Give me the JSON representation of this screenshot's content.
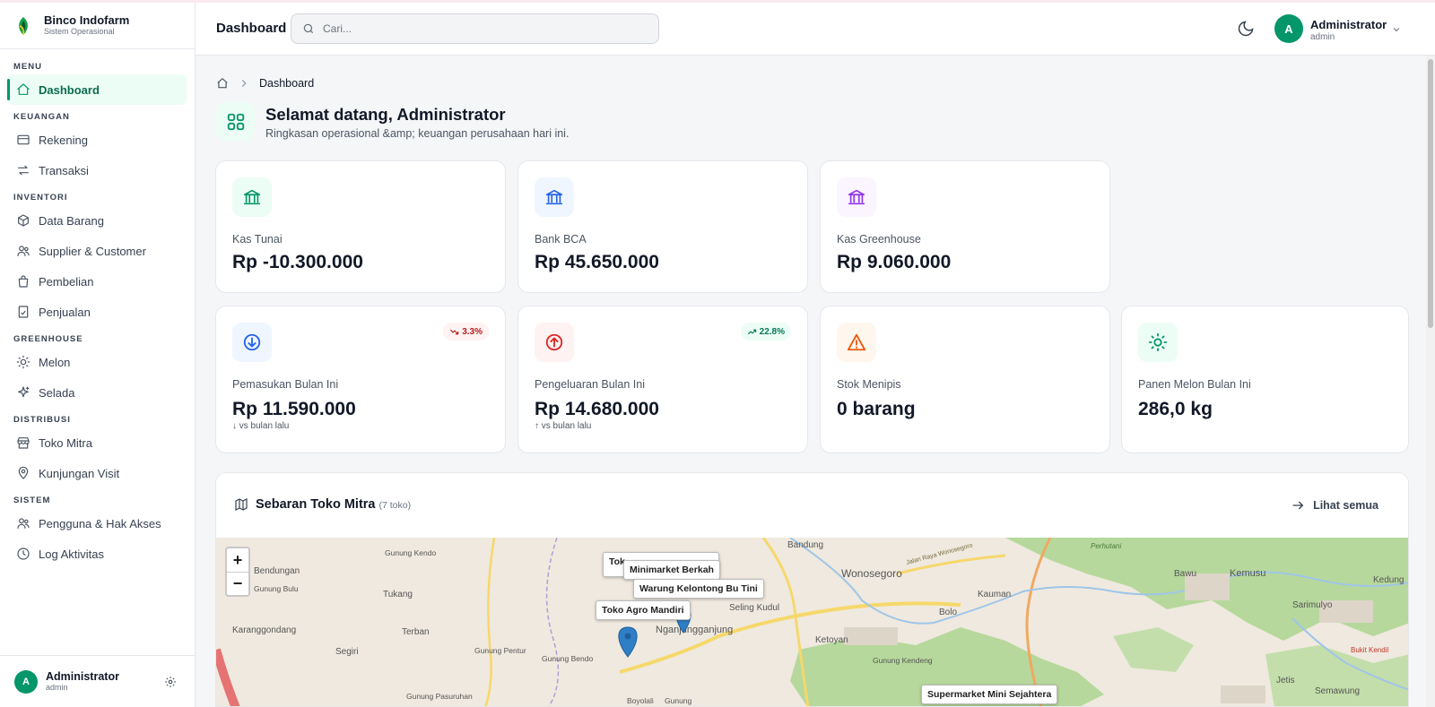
{
  "brand": {
    "name": "Binco Indofarm",
    "subtitle": "Sistem Operasional"
  },
  "sidebar": {
    "sections": [
      {
        "title": "MENU",
        "items": [
          {
            "label": "Dashboard",
            "icon": "home-icon",
            "active": true
          }
        ]
      },
      {
        "title": "KEUANGAN",
        "items": [
          {
            "label": "Rekening",
            "icon": "wallet-icon"
          },
          {
            "label": "Transaksi",
            "icon": "transfer-icon"
          }
        ]
      },
      {
        "title": "INVENTORI",
        "items": [
          {
            "label": "Data Barang",
            "icon": "box-icon"
          },
          {
            "label": "Supplier & Customer",
            "icon": "users-icon"
          },
          {
            "label": "Pembelian",
            "icon": "shopping-bag-icon"
          },
          {
            "label": "Penjualan",
            "icon": "receipt-icon"
          }
        ]
      },
      {
        "title": "GREENHOUSE",
        "items": [
          {
            "label": "Melon",
            "icon": "sun-icon"
          },
          {
            "label": "Selada",
            "icon": "sparkles-icon"
          }
        ]
      },
      {
        "title": "DISTRIBUSI",
        "items": [
          {
            "label": "Toko Mitra",
            "icon": "store-icon"
          },
          {
            "label": "Kunjungan Visit",
            "icon": "map-pin-icon"
          }
        ]
      },
      {
        "title": "SISTEM",
        "items": [
          {
            "label": "Pengguna & Hak Akses",
            "icon": "users-icon"
          },
          {
            "label": "Log Aktivitas",
            "icon": "clock-icon"
          }
        ]
      }
    ],
    "footer": {
      "avatar_initial": "A",
      "name": "Administrator",
      "role": "admin"
    }
  },
  "header": {
    "title": "Dashboard",
    "search_placeholder": "Cari...",
    "user": {
      "initial": "A",
      "name": "Administrator",
      "role": "admin"
    }
  },
  "breadcrumb": {
    "current": "Dashboard"
  },
  "welcome": {
    "title": "Selamat datang, Administrator",
    "subtitle": "Ringkasan operasional &amp; keuangan perusahaan hari ini."
  },
  "accounts": [
    {
      "label": "Kas Tunai",
      "value": "Rp -10.300.000",
      "icon": "bank-icon",
      "color": "#059669",
      "bg": "#ecfdf5"
    },
    {
      "label": "Bank BCA",
      "value": "Rp 45.650.000",
      "icon": "bank-icon",
      "color": "#2563eb",
      "bg": "#eff6ff"
    },
    {
      "label": "Kas Greenhouse",
      "value": "Rp 9.060.000",
      "icon": "bank-icon",
      "color": "#9333ea",
      "bg": "#faf5ff"
    }
  ],
  "stats": [
    {
      "label": "Pemasukan Bulan Ini",
      "value": "Rp 11.590.000",
      "note": "↓ vs bulan lalu",
      "badge": "3.3%",
      "badge_dir": "down",
      "icon": "arrow-down-circle-icon",
      "color": "#2563eb",
      "bg": "#eff6ff"
    },
    {
      "label": "Pengeluaran Bulan Ini",
      "value": "Rp 14.680.000",
      "note": "↑ vs bulan lalu",
      "badge": "22.8%",
      "badge_dir": "up",
      "icon": "arrow-up-circle-icon",
      "color": "#dc2626",
      "bg": "#fef2f2"
    },
    {
      "label": "Stok Menipis",
      "value": "0 barang",
      "icon": "alert-triangle-icon",
      "color": "#ea580c",
      "bg": "#fff7ed"
    },
    {
      "label": "Panen Melon Bulan Ini",
      "value": "286,0 kg",
      "icon": "sun-icon",
      "color": "#059669",
      "bg": "#ecfdf5"
    }
  ],
  "map": {
    "title": "Sebaran Toko Mitra",
    "count": "(7 toko)",
    "link": "Lihat semua",
    "zoom_in": "+",
    "zoom_out": "−",
    "places": [
      "Bendungan",
      "Gunung Kendo",
      "Gunung Bulu",
      "Tukang",
      "Karanggondang",
      "Terban",
      "Segiri",
      "Gunung Pentur",
      "Gunung Bendo",
      "Nganjungganjung",
      "Seling Kudul",
      "Bandung",
      "Wonosegoro",
      "Kauman",
      "Bolo",
      "Ketoyan",
      "Gunung Kendeng",
      "Bawu",
      "Kemusu",
      "Kedung",
      "Sarimulyo",
      "Jetis",
      "Semawung",
      "Bukit Kendil",
      "Gunung Pasuruhan",
      "Boyolali",
      "Gunung",
      "Perhutani",
      "Jalan Raya Wonosegoro"
    ],
    "labels": [
      {
        "text": "Tok"
      },
      {
        "text": "Minimarket Berkah"
      },
      {
        "text": "Warung Kelontong Bu Tini"
      },
      {
        "text": "Toko Agro Mandiri"
      },
      {
        "text": "Supermarket Mini Sejahtera"
      }
    ]
  }
}
